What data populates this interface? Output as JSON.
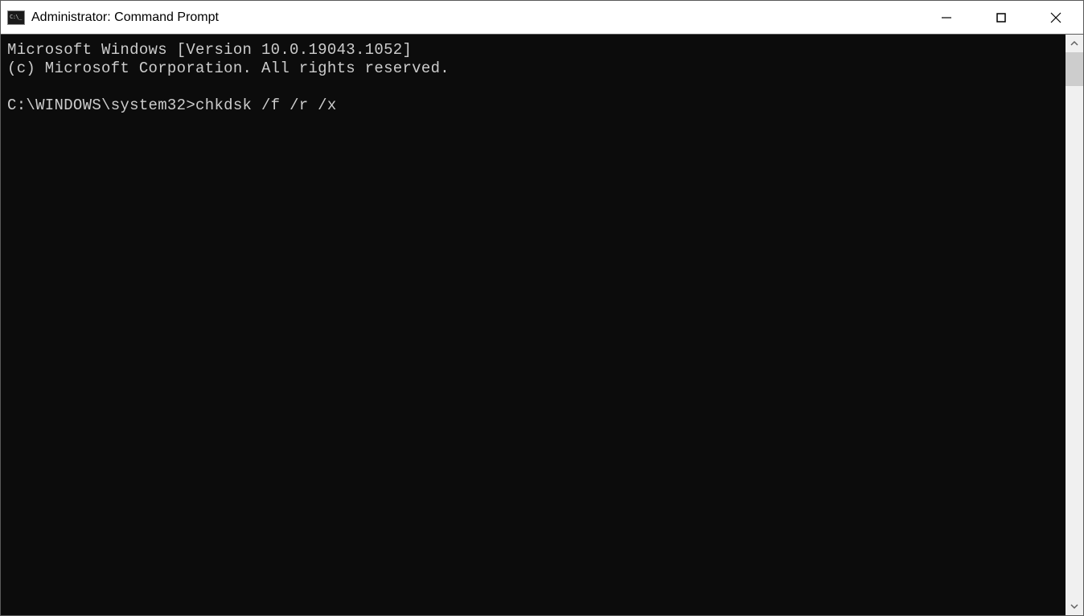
{
  "window": {
    "title": "Administrator: Command Prompt"
  },
  "terminal": {
    "line1": "Microsoft Windows [Version 10.0.19043.1052]",
    "line2": "(c) Microsoft Corporation. All rights reserved.",
    "blank": "",
    "prompt": "C:\\WINDOWS\\system32>",
    "command": "chkdsk /f /r /x"
  }
}
